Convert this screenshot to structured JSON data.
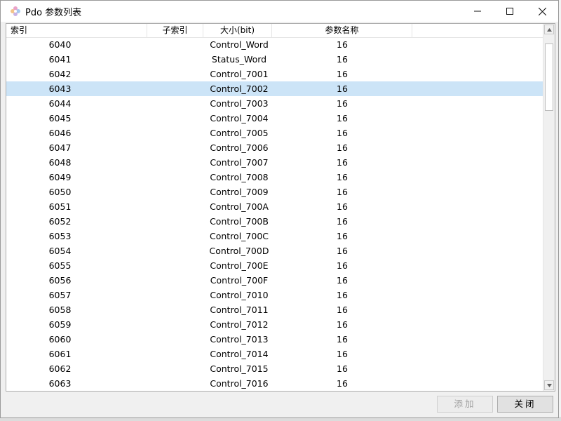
{
  "window": {
    "title": "Pdo 参数列表",
    "controls": {
      "minimize_icon": "minimize-icon",
      "maximize_icon": "maximize-icon",
      "close_icon": "close-icon"
    }
  },
  "table": {
    "columns": [
      "索引",
      "子索引",
      "大小(bit)",
      "参数名称"
    ],
    "selected_index": "6043",
    "rows": [
      {
        "index": "6040",
        "subindex": "",
        "name": "Control_Word",
        "size": "16"
      },
      {
        "index": "6041",
        "subindex": "",
        "name": "Status_Word",
        "size": "16"
      },
      {
        "index": "6042",
        "subindex": "",
        "name": "Control_7001",
        "size": "16"
      },
      {
        "index": "6043",
        "subindex": "",
        "name": "Control_7002",
        "size": "16"
      },
      {
        "index": "6044",
        "subindex": "",
        "name": "Control_7003",
        "size": "16"
      },
      {
        "index": "6045",
        "subindex": "",
        "name": "Control_7004",
        "size": "16"
      },
      {
        "index": "6046",
        "subindex": "",
        "name": "Control_7005",
        "size": "16"
      },
      {
        "index": "6047",
        "subindex": "",
        "name": "Control_7006",
        "size": "16"
      },
      {
        "index": "6048",
        "subindex": "",
        "name": "Control_7007",
        "size": "16"
      },
      {
        "index": "6049",
        "subindex": "",
        "name": "Control_7008",
        "size": "16"
      },
      {
        "index": "6050",
        "subindex": "",
        "name": "Control_7009",
        "size": "16"
      },
      {
        "index": "6051",
        "subindex": "",
        "name": "Control_700A",
        "size": "16"
      },
      {
        "index": "6052",
        "subindex": "",
        "name": "Control_700B",
        "size": "16"
      },
      {
        "index": "6053",
        "subindex": "",
        "name": "Control_700C",
        "size": "16"
      },
      {
        "index": "6054",
        "subindex": "",
        "name": "Control_700D",
        "size": "16"
      },
      {
        "index": "6055",
        "subindex": "",
        "name": "Control_700E",
        "size": "16"
      },
      {
        "index": "6056",
        "subindex": "",
        "name": "Control_700F",
        "size": "16"
      },
      {
        "index": "6057",
        "subindex": "",
        "name": "Control_7010",
        "size": "16"
      },
      {
        "index": "6058",
        "subindex": "",
        "name": "Control_7011",
        "size": "16"
      },
      {
        "index": "6059",
        "subindex": "",
        "name": "Control_7012",
        "size": "16"
      },
      {
        "index": "6060",
        "subindex": "",
        "name": "Control_7013",
        "size": "16"
      },
      {
        "index": "6061",
        "subindex": "",
        "name": "Control_7014",
        "size": "16"
      },
      {
        "index": "6062",
        "subindex": "",
        "name": "Control_7015",
        "size": "16"
      },
      {
        "index": "6063",
        "subindex": "",
        "name": "Control_7016",
        "size": "16"
      }
    ]
  },
  "buttons": {
    "add_label": "添加",
    "close_label": "关闭"
  },
  "colors": {
    "selection": "#cce4f7",
    "window_bg": "#f0f0f0"
  }
}
